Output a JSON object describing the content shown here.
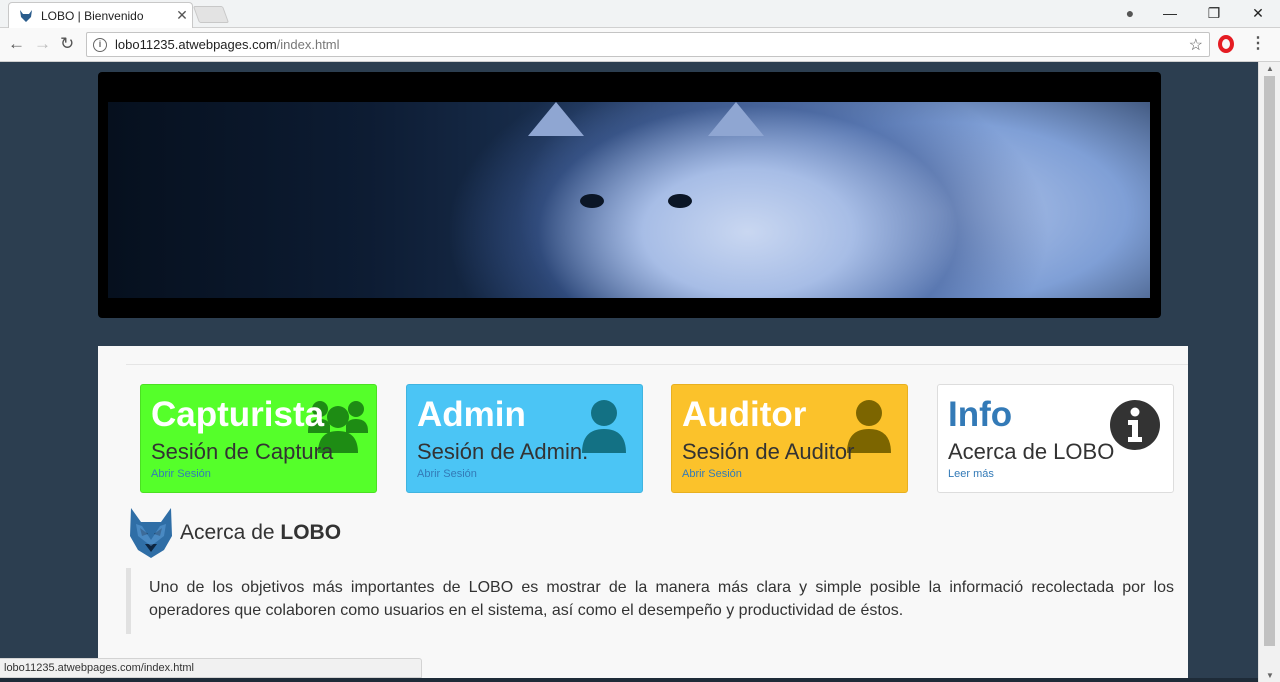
{
  "browser": {
    "tab_title": "LOBO | Bienvenido",
    "tab_close": "✕",
    "url_host": "lobo11235.atwebpages.com",
    "url_path": "/index.html",
    "status_url": "lobo11235.atwebpages.com/index.html",
    "window_controls": {
      "minimize": "—",
      "restore": "❐",
      "close": "✕"
    }
  },
  "cards": [
    {
      "title": "Capturista",
      "subtitle": "Sesión de Captura",
      "link": "Abrir Sesión",
      "icon": "users-icon",
      "color": "#55ff2a"
    },
    {
      "title": "Admin",
      "subtitle": "Sesión de Admin.",
      "link": "Abrir Sesión",
      "icon": "user-icon",
      "color": "#4bc5f5"
    },
    {
      "title": "Auditor",
      "subtitle": "Sesión de Auditor",
      "link": "Abrir Sesión",
      "icon": "user-icon",
      "color": "#fbc22b"
    },
    {
      "title": "Info",
      "subtitle": "Acerca de LOBO",
      "link": "Leer más",
      "icon": "info-circle-icon",
      "color": "#ffffff"
    }
  ],
  "about": {
    "title_prefix": "Acerca de ",
    "title_bold": "LOBO",
    "text": "Uno de los objetivos más importantes de LOBO es mostrar de la manera más clara y simple posible la informació recolectada por los operadores que colaboren como usuarios en el sistema, así como el desempeño y productividad de éstos."
  },
  "colors": {
    "page_background": "#2c3e50",
    "link": "#337ab7"
  }
}
